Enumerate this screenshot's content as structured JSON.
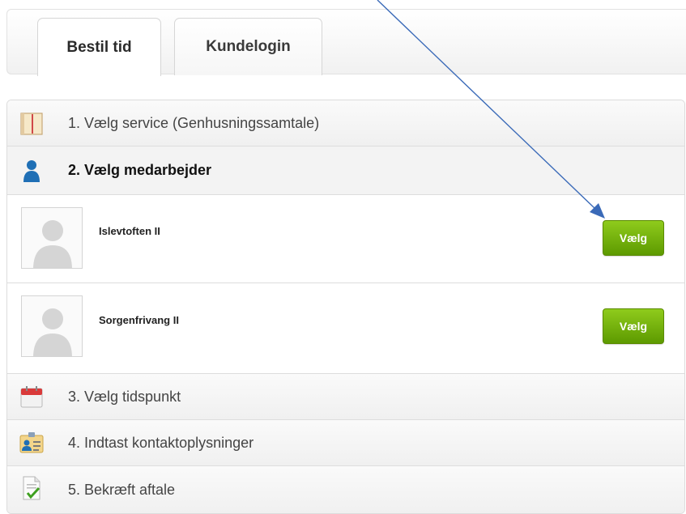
{
  "tabs": [
    {
      "label": "Bestil tid",
      "active": true
    },
    {
      "label": "Kundelogin",
      "active": false
    }
  ],
  "steps": {
    "service": {
      "label": "1. Vælg service (Genhusningssamtale)",
      "icon": "book-icon"
    },
    "staff": {
      "label": "2. Vælg medarbejder",
      "icon": "person-icon"
    },
    "time": {
      "label": "3. Vælg tidspunkt",
      "icon": "calendar-icon"
    },
    "contact": {
      "label": "4. Indtast kontaktoplysninger",
      "icon": "contact-card-icon"
    },
    "confirm": {
      "label": "5. Bekræft aftale",
      "icon": "document-check-icon"
    }
  },
  "employees": [
    {
      "name": "Islevtoften II",
      "button": "Vælg"
    },
    {
      "name": "Sorgenfrivang II",
      "button": "Vælg"
    }
  ],
  "colors": {
    "button_green": "#6fae0a",
    "arrow_blue": "#3a6ab8",
    "person_blue": "#1f6fb5"
  }
}
